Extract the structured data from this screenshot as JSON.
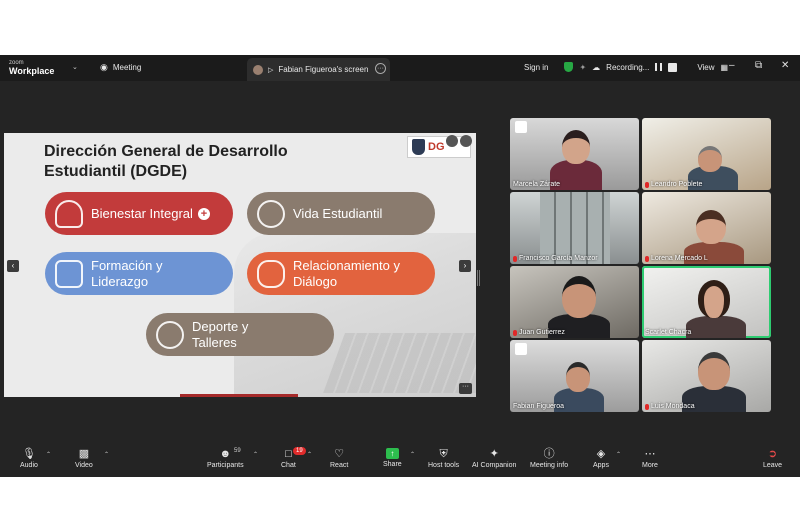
{
  "app": {
    "brand_top": "zoom",
    "brand_name": "Workplace",
    "meeting_tab": "Meeting",
    "share_tab": "Fabian Figueroa's screen",
    "sign_in": "Sign in",
    "recording": "Recording...",
    "view": "View"
  },
  "slide": {
    "title": "Dirección General de Desarrollo Estudiantil (DGDE)",
    "logo_text": "DG",
    "items": [
      {
        "label": "Bienestar Integral",
        "color": "#c23b3b",
        "icon": "lotus-icon"
      },
      {
        "label": "Vida Estudiantil",
        "color": "#8a7b6e",
        "icon": "student-icon"
      },
      {
        "label": "Formación y Liderazgo",
        "color": "#6d94d4",
        "icon": "thumbs-up-icon"
      },
      {
        "label": "Relacionamiento y Diálogo",
        "color": "#e2633e",
        "icon": "handshake-icon"
      },
      {
        "label": "Deporte y Talleres",
        "color": "#8a7b6e",
        "icon": "medal-icon"
      }
    ]
  },
  "participants": [
    {
      "name": "Marcela Zárate",
      "muted": false
    },
    {
      "name": "Leandro Poblete",
      "muted": true
    },
    {
      "name": "Francisco García Manzor",
      "muted": true
    },
    {
      "name": "Lorena Mercado L",
      "muted": true
    },
    {
      "name": "Juan Gutierrez",
      "muted": true
    },
    {
      "name": "Scarlet Chacra",
      "muted": false
    },
    {
      "name": "Fabian Figueroa",
      "muted": false
    },
    {
      "name": "Luis Mondaca",
      "muted": true
    }
  ],
  "toolbar": {
    "audio": "Audio",
    "video": "Video",
    "participants": "Participants",
    "participants_count": "59",
    "chat": "Chat",
    "chat_badge": "19",
    "react": "React",
    "share": "Share",
    "host_tools": "Host tools",
    "ai_companion": "AI Companion",
    "meeting_info": "Meeting info",
    "apps": "Apps",
    "more": "More",
    "leave": "Leave"
  }
}
